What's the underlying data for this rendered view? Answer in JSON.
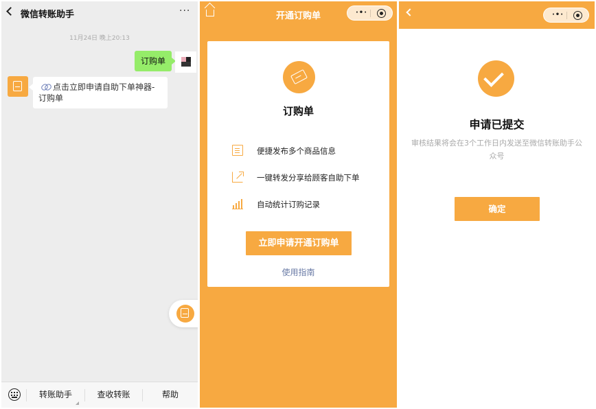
{
  "chat": {
    "title": "微信转账助手",
    "more": "···",
    "timestamp": "11月24日 晚上20:13",
    "sent_message": "订购单",
    "received_link_text": "点击立即申请自助下单神器-订购单",
    "bottom_menu": [
      "转账助手",
      "查收转账",
      "帮助"
    ]
  },
  "apply_page": {
    "title": "开通订购单",
    "capsule_more": "·•·",
    "card_title": "订购单",
    "features": [
      {
        "icon": "document-icon",
        "text": "便捷发布多个商品信息"
      },
      {
        "icon": "share-icon",
        "text": "一键转发分享给顾客自助下单"
      },
      {
        "icon": "bar-chart-icon",
        "text": "自动统计订购记录"
      }
    ],
    "apply_button": "立即申请开通订购单",
    "guide_link": "使用指南"
  },
  "result_page": {
    "capsule_more": "·•·",
    "title": "申请已提交",
    "description": "审核结果将会在3个工作日内发送至微信转账助手公众号",
    "confirm_button": "确定"
  },
  "colors": {
    "accent": "#f7a941",
    "chat_bg": "#ededed",
    "sent_bubble": "#95ec69",
    "link_blue": "#6a7ba6"
  }
}
